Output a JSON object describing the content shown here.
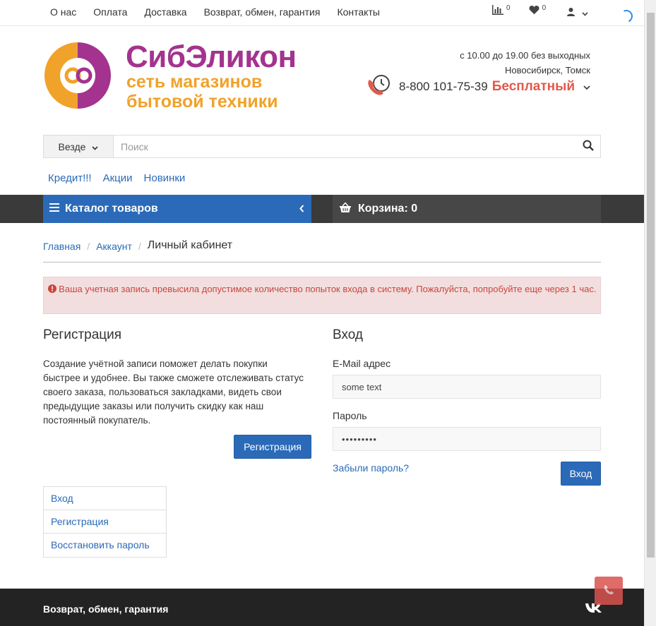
{
  "topnav": [
    "О нас",
    "Оплата",
    "Доставка",
    "Возврат, обмен, гарантия",
    "Контакты"
  ],
  "top_icons": {
    "compare_icon": "bar-chart-icon",
    "compare_count": "0",
    "wishlist_icon": "heart-icon",
    "wishlist_count": "0",
    "account_icon": "user-icon"
  },
  "logo": {
    "name": "СибЭликон",
    "tagline_line1": "сеть магазинов",
    "tagline_line2": "бытовой техники"
  },
  "contacts": {
    "hours": "с 10.00 до 19.00 без выходных",
    "cities": "Новосибирск, Томск",
    "phone": "8-800 101-75-39",
    "phone_note": "Бесплатный"
  },
  "search": {
    "scope": "Везде",
    "placeholder": "Поиск"
  },
  "quicklinks": [
    "Кредит!!!",
    "Акции",
    "Новинки"
  ],
  "menubar": {
    "catalog_label": "Каталог товаров",
    "cart_label": "Корзина: 0"
  },
  "breadcrumb": {
    "home": "Главная",
    "account": "Аккаунт",
    "current": "Личный кабинет"
  },
  "alert": {
    "text": "Ваша учетная запись превысила допустимое количество попыток входа в систему. Пожалуйста, попробуйте еще через 1 час."
  },
  "register": {
    "title": "Регистрация",
    "text": "Создание учётной записи поможет делать покупки быстрее и удобнее. Вы также сможете отслеживать статус своего заказа, пользоваться закладками, видеть свои предыдущие заказы или получить скидку как наш постоянный покупатель.",
    "button": "Регистрация"
  },
  "login": {
    "title": "Вход",
    "email_label": "E-Mail адрес",
    "email_value": "some text",
    "password_label": "Пароль",
    "password_value": "•••••••••",
    "forgot": "Забыли пароль?",
    "button": "Вход"
  },
  "sidelist": [
    "Вход",
    "Регистрация",
    "Восстановить пароль"
  ],
  "footer": {
    "link": "Возврат, обмен, гарантия",
    "social": "vk"
  },
  "colors": {
    "primary": "#2a6ab8",
    "brand_purple": "#a3338e",
    "brand_orange": "#f0a22a",
    "alert_text": "#c9463d",
    "alert_bg": "#f2dede"
  }
}
